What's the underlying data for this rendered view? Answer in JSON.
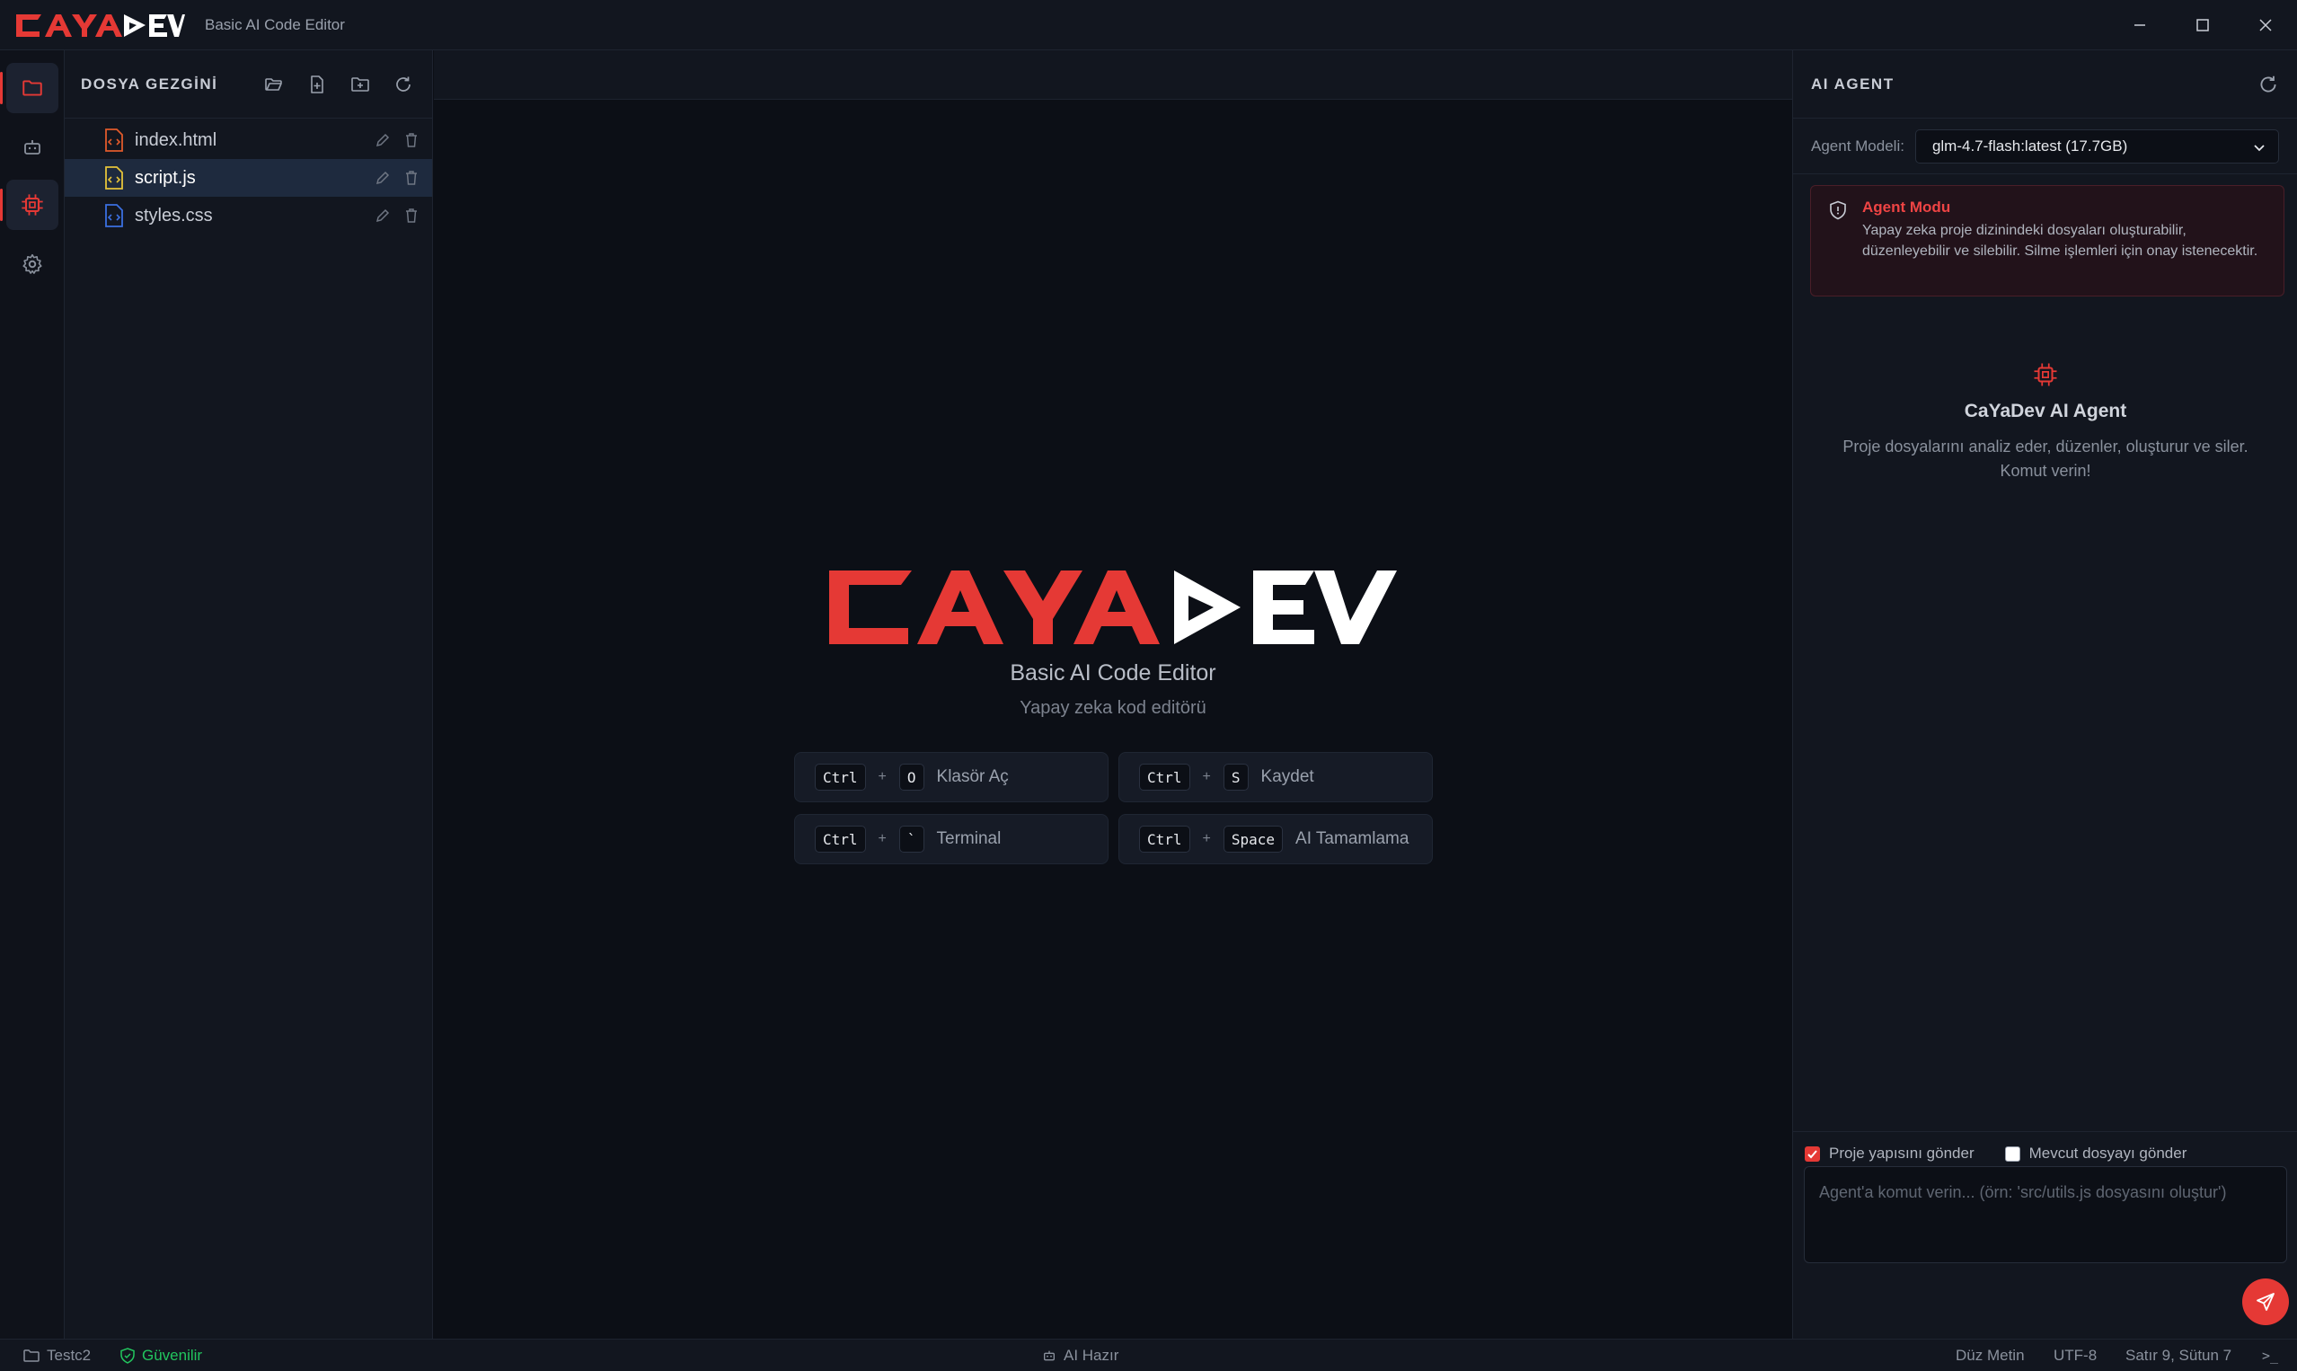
{
  "window": {
    "logo_text": "CAYADEV",
    "title": "Basic AI Code Editor",
    "controls": [
      "minimize-icon",
      "maximize-icon",
      "close-icon"
    ]
  },
  "activity_bar": {
    "items": [
      {
        "name": "explorer",
        "icon": "folder-icon",
        "active": true
      },
      {
        "name": "ai-chat",
        "icon": "robot-icon",
        "active": false
      },
      {
        "name": "ai-agent",
        "icon": "chip-icon",
        "active": true
      },
      {
        "name": "settings",
        "icon": "gear-icon",
        "active": false
      }
    ]
  },
  "explorer": {
    "title": "DOSYA GEZGİNİ",
    "actions": [
      "open-folder-icon",
      "new-file-icon",
      "new-folder-icon",
      "refresh-icon"
    ],
    "files": [
      {
        "name": "index.html",
        "type": "html",
        "color": "#e05a2b",
        "selected": false
      },
      {
        "name": "script.js",
        "type": "js",
        "color": "#e5c33a",
        "selected": true
      },
      {
        "name": "styles.css",
        "type": "css",
        "color": "#3b6fe0",
        "selected": false
      }
    ]
  },
  "welcome": {
    "logo_text": "CAYADEV",
    "title": "Basic AI Code Editor",
    "subtitle": "Yapay zeka kod editörü",
    "shortcuts": [
      {
        "keys": [
          "Ctrl",
          "O"
        ],
        "label": "Klasör Aç"
      },
      {
        "keys": [
          "Ctrl",
          "S"
        ],
        "label": "Kaydet"
      },
      {
        "keys": [
          "Ctrl",
          "`"
        ],
        "label": "Terminal"
      },
      {
        "keys": [
          "Ctrl",
          "Space"
        ],
        "label": "AI Tamamlama"
      }
    ],
    "plus": "+"
  },
  "ai_panel": {
    "title": "AI AGENT",
    "model_label": "Agent Modeli:",
    "model_value": "glm-4.7-flash:latest (17.7GB)",
    "agent_mode": {
      "title": "Agent Modu",
      "text": "Yapay zeka proje dizinindeki dosyaları oluşturabilir, düzenleyebilir ve silebilir. Silme işlemleri için onay istenecektir."
    },
    "agent_name": "CaYaDev AI Agent",
    "agent_desc": "Proje dosyalarını analiz eder, düzenler, oluşturur ve siler. Komut verin!",
    "options": [
      {
        "label": "Proje yapısını gönder",
        "checked": true
      },
      {
        "label": "Mevcut dosyayı gönder",
        "checked": false
      }
    ],
    "prompt_placeholder": "Agent'a komut verin... (örn: 'src/utils.js dosyasını oluştur')"
  },
  "status_bar": {
    "folder": "Testc2",
    "trust": "Güvenilir",
    "ai_status": "AI Hazır",
    "language": "Düz Metin",
    "encoding": "UTF-8",
    "position": "Satır 9, Sütun 7",
    "terminal_glyph": ">_"
  },
  "colors": {
    "accent": "#e53935",
    "background": "#0c0f16",
    "panel": "#12161f",
    "success": "#22c55e"
  }
}
